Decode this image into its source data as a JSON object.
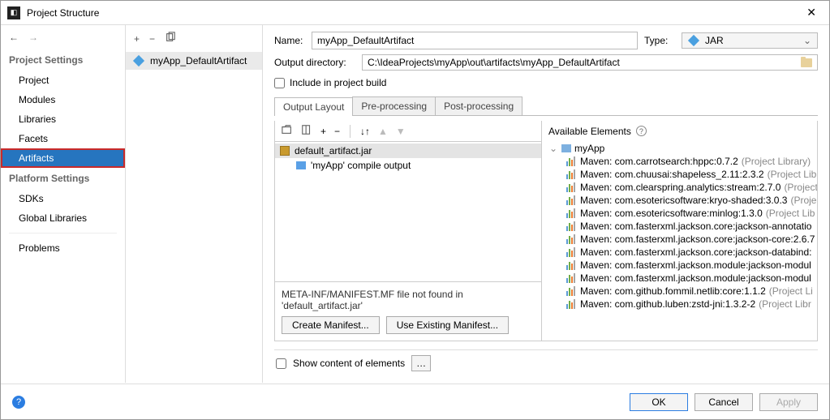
{
  "window": {
    "title": "Project Structure"
  },
  "sidebar": {
    "section1": "Project Settings",
    "section2": "Platform Settings",
    "items1": [
      "Project",
      "Modules",
      "Libraries",
      "Facets",
      "Artifacts"
    ],
    "items2": [
      "SDKs",
      "Global Libraries"
    ],
    "problems": "Problems"
  },
  "midlist": {
    "entry": "myApp_DefaultArtifact"
  },
  "detail": {
    "name_label": "Name:",
    "name_value": "myApp_DefaultArtifact",
    "type_label": "Type:",
    "type_value": "JAR",
    "outdir_label": "Output directory:",
    "outdir_value": "C:\\IdeaProjects\\myApp\\out\\artifacts\\myApp_DefaultArtifact",
    "include_label": "Include in project build",
    "tabs": [
      "Output Layout",
      "Pre-processing",
      "Post-processing"
    ],
    "jar_name": "default_artifact.jar",
    "compile_output": "'myApp' compile output",
    "manifest_msg": "META-INF/MANIFEST.MF file not found in 'default_artifact.jar'",
    "create_manifest": "Create Manifest...",
    "use_manifest": "Use Existing Manifest...",
    "available_header": "Available Elements",
    "root_module": "myApp",
    "libs": [
      {
        "name": "Maven: com.carrotsearch:hppc:0.7.2",
        "note": "(Project Library)"
      },
      {
        "name": "Maven: com.chuusai:shapeless_2.11:2.3.2",
        "note": "(Project Libr"
      },
      {
        "name": "Maven: com.clearspring.analytics:stream:2.7.0",
        "note": "(Project"
      },
      {
        "name": "Maven: com.esotericsoftware:kryo-shaded:3.0.3",
        "note": "(Proje"
      },
      {
        "name": "Maven: com.esotericsoftware:minlog:1.3.0",
        "note": "(Project Lib"
      },
      {
        "name": "Maven: com.fasterxml.jackson.core:jackson-annotatio",
        "note": ""
      },
      {
        "name": "Maven: com.fasterxml.jackson.core:jackson-core:2.6.7",
        "note": ""
      },
      {
        "name": "Maven: com.fasterxml.jackson.core:jackson-databind:",
        "note": ""
      },
      {
        "name": "Maven: com.fasterxml.jackson.module:jackson-modul",
        "note": ""
      },
      {
        "name": "Maven: com.fasterxml.jackson.module:jackson-modul",
        "note": ""
      },
      {
        "name": "Maven: com.github.fommil.netlib:core:1.1.2",
        "note": "(Project Li"
      },
      {
        "name": "Maven: com.github.luben:zstd-jni:1.3.2-2",
        "note": "(Project Libr"
      }
    ],
    "show_content": "Show content of elements"
  },
  "footer": {
    "ok": "OK",
    "cancel": "Cancel",
    "apply": "Apply"
  }
}
